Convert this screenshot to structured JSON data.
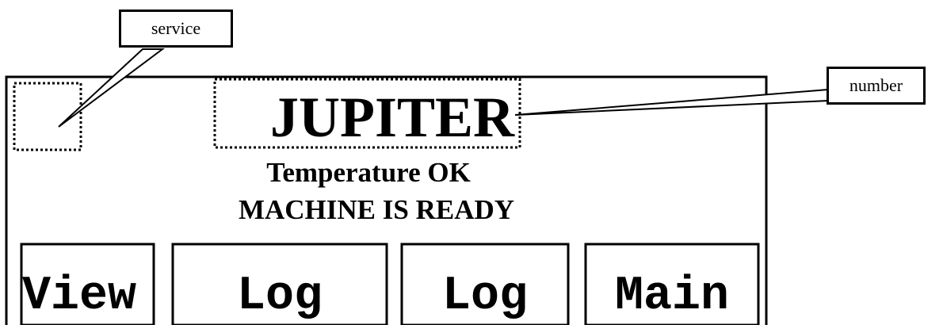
{
  "callouts": {
    "service": "service",
    "number": "number"
  },
  "screen": {
    "title": "JUPITER",
    "status_line_1": "Temperature OK",
    "status_line_2": "MACHINE IS READY"
  },
  "buttons": [
    {
      "label": "View"
    },
    {
      "label": "Log"
    },
    {
      "label": "Log"
    },
    {
      "label": "Main"
    }
  ]
}
